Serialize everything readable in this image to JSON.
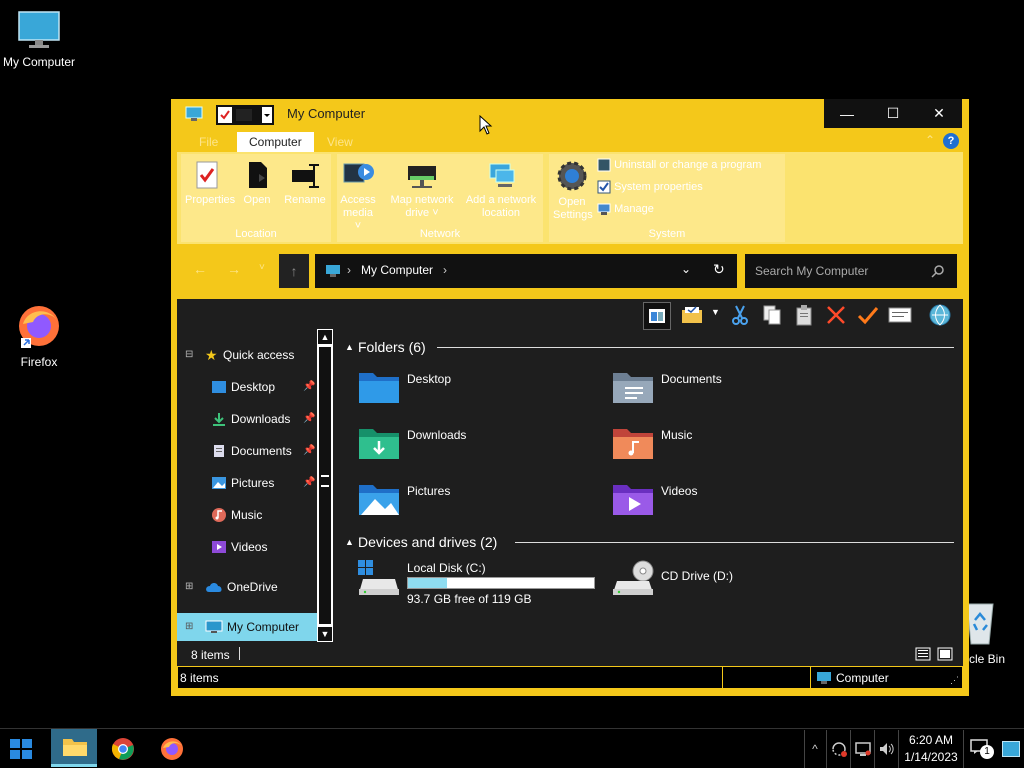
{
  "desktop": {
    "icons": [
      {
        "label": "My Computer"
      },
      {
        "label": "Firefox"
      },
      {
        "label": "cle Bin"
      }
    ]
  },
  "window": {
    "title": "My Computer",
    "controls": {
      "minimize": "—",
      "maximize": "☐",
      "close": "✕"
    },
    "ribbon_tabs": [
      "File",
      "Computer",
      "View"
    ],
    "active_tab": "Computer",
    "help_icon": "?",
    "ribbon": {
      "groups": [
        {
          "label": "Location",
          "items": [
            "Properties",
            "Open",
            "Rename"
          ]
        },
        {
          "label": "Network",
          "items": [
            "Access media ˅",
            "Map network drive ˅",
            "Add a network location"
          ]
        },
        {
          "label": "System",
          "open_settings": "Open Settings",
          "small_items": [
            "Uninstall or change a program",
            "System properties",
            "Manage"
          ]
        }
      ]
    },
    "navigation": {
      "address_text": "My Computer",
      "search_placeholder": "Search My Computer"
    },
    "sidebar": {
      "items": [
        {
          "label": "Quick access",
          "expander": "⊟"
        },
        {
          "label": "Desktop",
          "pinned": true
        },
        {
          "label": "Downloads",
          "pinned": true
        },
        {
          "label": "Documents",
          "pinned": true
        },
        {
          "label": "Pictures",
          "pinned": true
        },
        {
          "label": "Music"
        },
        {
          "label": "Videos"
        },
        {
          "label": "OneDrive",
          "expander": "⊞"
        },
        {
          "label": "My Computer",
          "expander": "⊞"
        }
      ]
    },
    "folders_header": "Folders (6)",
    "folders": [
      "Desktop",
      "Documents",
      "Downloads",
      "Music",
      "Pictures",
      "Videos"
    ],
    "drives_header": "Devices and drives (2)",
    "drives": [
      {
        "name": "Local Disk (C:)",
        "free_text": "93.7 GB free of 119 GB",
        "used_fraction": 0.21
      },
      {
        "name": "CD Drive (D:)"
      }
    ],
    "status_items": "8 items",
    "status_bar": {
      "left": "8 items",
      "right": "Computer"
    }
  },
  "taskbar": {
    "time": "6:20 AM",
    "date": "1/14/2023",
    "notification_count": "1"
  },
  "colors": {
    "window_accent": "#f4c81a",
    "ribbon_bg": "#fbe36f",
    "content_bg": "#1e1e1e",
    "selection": "#7fd6ec",
    "drive_bar": "#8fdcf0"
  }
}
